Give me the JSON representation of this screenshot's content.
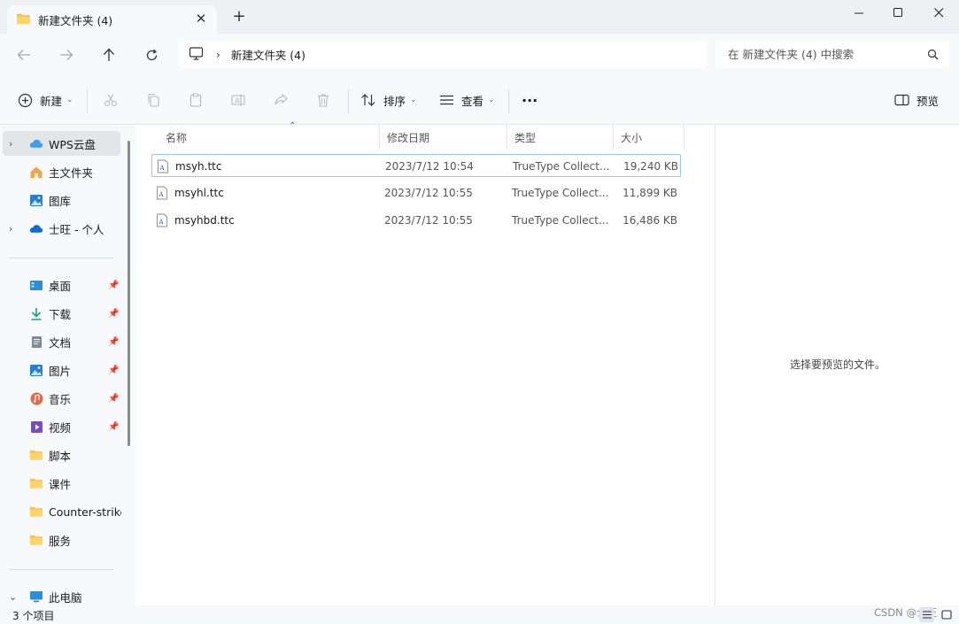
{
  "window": {
    "tab_title": "新建文件夹 (4)",
    "colors": {
      "folder": "#f6c343",
      "accent": "#0067c0",
      "selection_border": "#99c6ea"
    }
  },
  "address": {
    "breadcrumb": "新建文件夹 (4)",
    "search_placeholder": "在 新建文件夹 (4) 中搜索"
  },
  "toolbar": {
    "new_label": "新建",
    "sort_label": "排序",
    "view_label": "查看",
    "more_label": "···",
    "preview_label": "预览"
  },
  "sidebar": {
    "items": [
      {
        "label": "WPS云盘",
        "icon": "wps-cloud-icon"
      },
      {
        "label": "主文件夹",
        "icon": "home-icon"
      },
      {
        "label": "图库",
        "icon": "gallery-icon"
      },
      {
        "label": "士旺 - 个人",
        "icon": "onedrive-icon"
      }
    ],
    "quick_access": [
      {
        "label": "桌面",
        "icon": "desktop-icon"
      },
      {
        "label": "下载",
        "icon": "download-icon"
      },
      {
        "label": "文档",
        "icon": "document-icon"
      },
      {
        "label": "图片",
        "icon": "pictures-icon"
      },
      {
        "label": "音乐",
        "icon": "music-icon"
      },
      {
        "label": "视频",
        "icon": "video-icon"
      },
      {
        "label": "脚本",
        "icon": "folder-icon"
      },
      {
        "label": "课件",
        "icon": "folder-icon"
      },
      {
        "label": "Counter-strike",
        "icon": "folder-icon"
      },
      {
        "label": "服务",
        "icon": "folder-icon"
      }
    ],
    "this_pc": "此电脑"
  },
  "columns": {
    "name": "名称",
    "date": "修改日期",
    "type": "类型",
    "size": "大小"
  },
  "files": [
    {
      "name": "msyh.ttc",
      "date": "2023/7/12 10:54",
      "type": "TrueType Collect...",
      "size": "19,240 KB"
    },
    {
      "name": "msyhl.ttc",
      "date": "2023/7/12 10:55",
      "type": "TrueType Collect...",
      "size": "11,899 KB"
    },
    {
      "name": "msyhbd.ttc",
      "date": "2023/7/12 10:55",
      "type": "TrueType Collect...",
      "size": "16,486 KB"
    }
  ],
  "preview": {
    "empty_message": "选择要预览的文件。"
  },
  "status": {
    "count": "3 个项目",
    "watermark": "CSDN @士旺"
  }
}
